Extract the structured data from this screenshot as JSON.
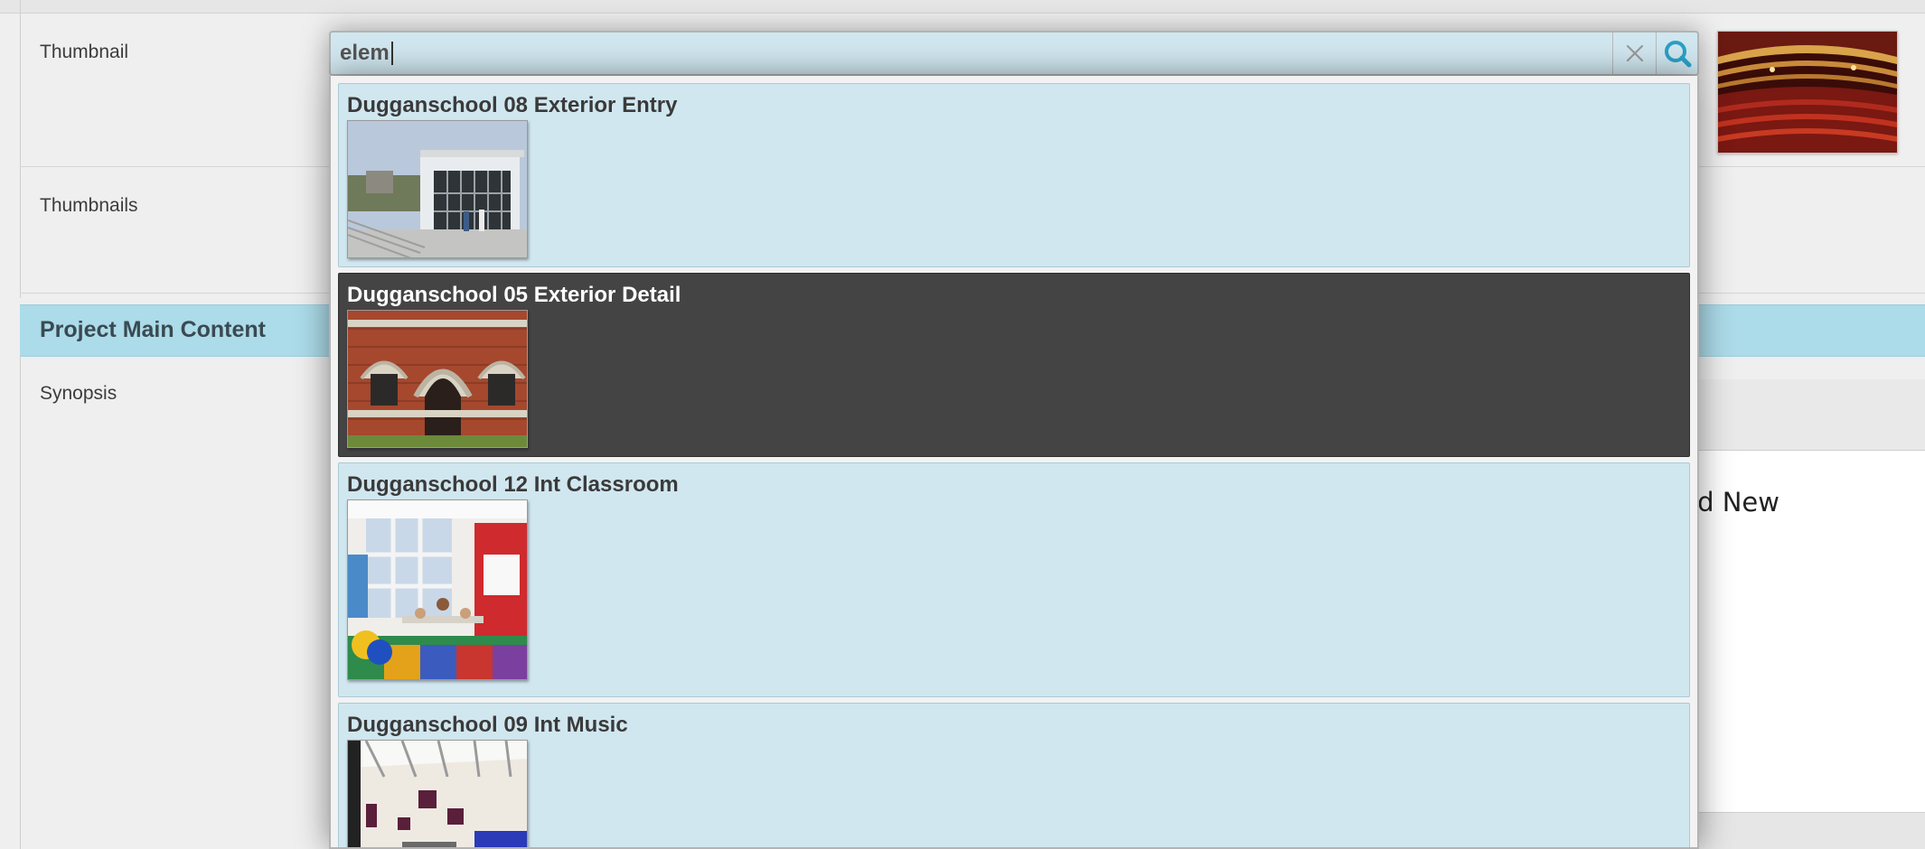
{
  "form": {
    "thumbnail_label": "Thumbnail",
    "thumbnails_label": "Thumbnails",
    "section_title": "Project Main Content",
    "synopsis_label": "Synopsis",
    "synopsis_visible_text": "Add New"
  },
  "search": {
    "value": "elem",
    "clear_icon": "close-icon",
    "search_icon": "search-icon"
  },
  "results": [
    {
      "title": "Dugganschool 08 Exterior Entry",
      "highlighted": false
    },
    {
      "title": "Dugganschool 05 Exterior Detail",
      "highlighted": true
    },
    {
      "title": "Dugganschool 12 Int Classroom",
      "highlighted": false
    },
    {
      "title": "Dugganschool 09 Int Music",
      "highlighted": false
    }
  ],
  "colors": {
    "accent": "#acdbe9",
    "item_bg": "#d1e7f0",
    "item_active_bg": "#444444",
    "search_icon": "#2aa1c7"
  }
}
